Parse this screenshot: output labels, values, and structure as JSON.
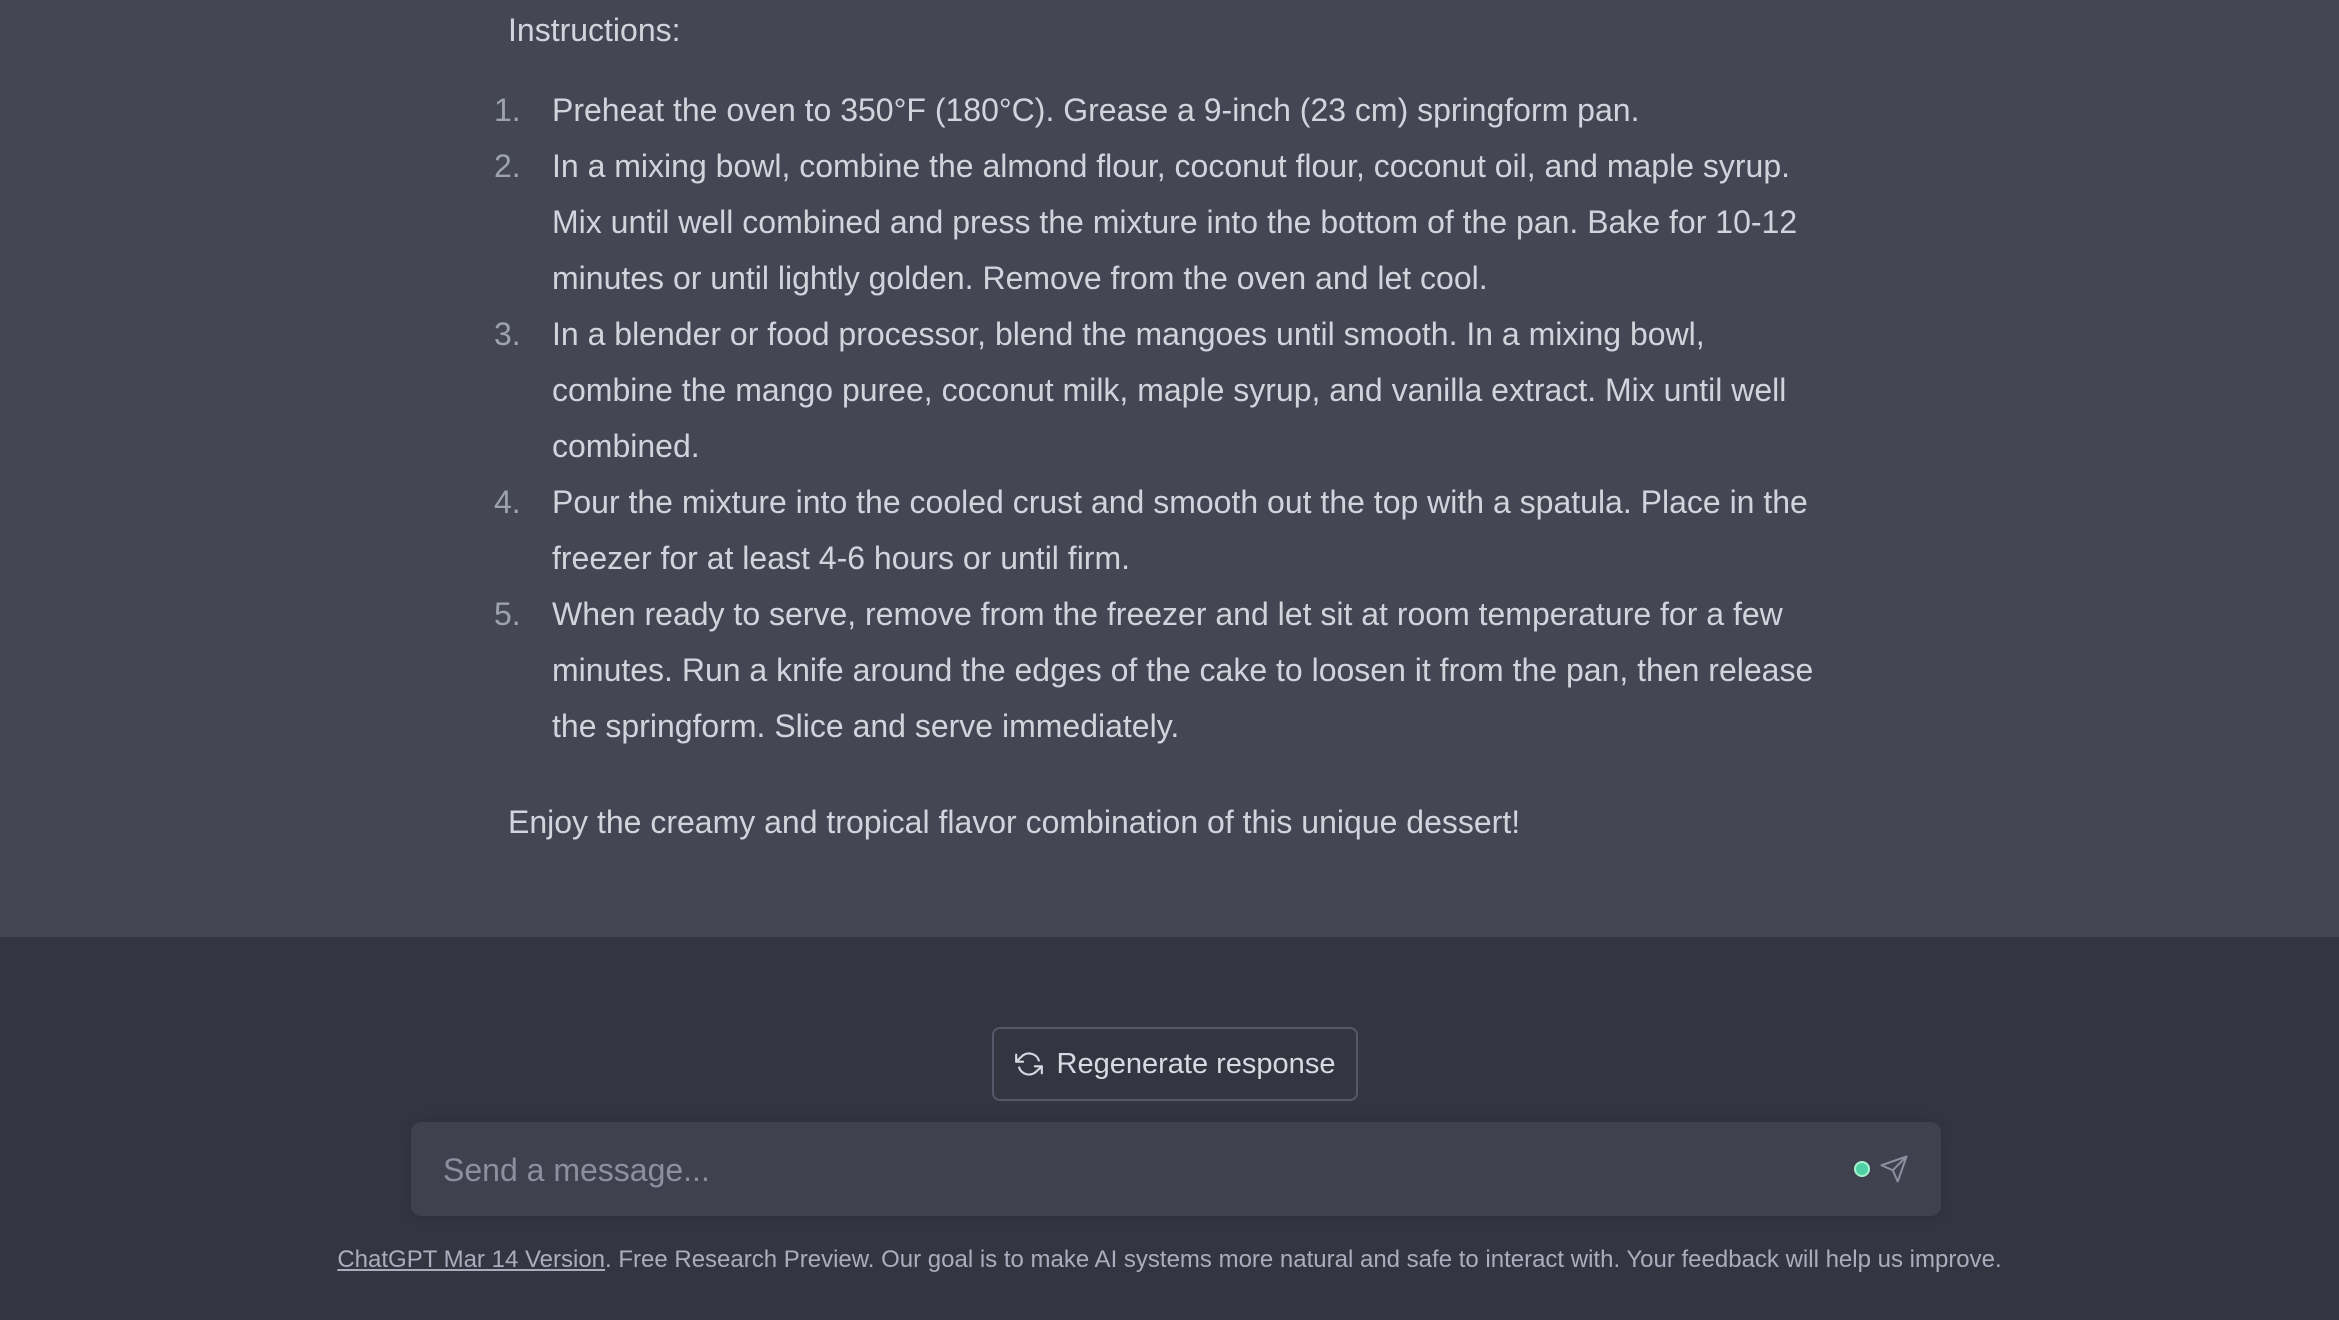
{
  "response": {
    "heading": "Instructions:",
    "steps": [
      {
        "number": "1.",
        "text": "Preheat the oven to 350°F (180°C). Grease a 9-inch (23 cm) springform pan."
      },
      {
        "number": "2.",
        "text": "In a mixing bowl, combine the almond flour, coconut flour, coconut oil, and maple syrup. Mix until well combined and press the mixture into the bottom of the pan. Bake for 10-12 minutes or until lightly golden. Remove from the oven and let cool."
      },
      {
        "number": "3.",
        "text": "In a blender or food processor, blend the mangoes until smooth. In a mixing bowl, combine the mango puree, coconut milk, maple syrup, and vanilla extract. Mix until well combined."
      },
      {
        "number": "4.",
        "text": "Pour the mixture into the cooled crust and smooth out the top with a spatula. Place in the freezer for at least 4-6 hours or until firm."
      },
      {
        "number": "5.",
        "text": "When ready to serve, remove from the freezer and let sit at room temperature for a few minutes. Run a knife around the edges of the cake to loosen it from the pan, then release the springform. Slice and serve immediately."
      }
    ],
    "closing": "Enjoy the creamy and tropical flavor combination of this unique dessert!"
  },
  "controls": {
    "regenerate_label": "Regenerate response",
    "regenerate_icon": "refresh-icon",
    "input_placeholder": "Send a message...",
    "send_icon": "paper-plane-icon",
    "status_color": "#4fd1a5"
  },
  "footer": {
    "version_link": "ChatGPT Mar 14 Version",
    "text": ". Free Research Preview. Our goal is to make AI systems more natural and safe to interact with. Your feedback will help us improve."
  },
  "colors": {
    "response_bg": "#444654",
    "page_bg": "#343541",
    "input_bg": "#40414f",
    "text": "#d1d5db"
  }
}
